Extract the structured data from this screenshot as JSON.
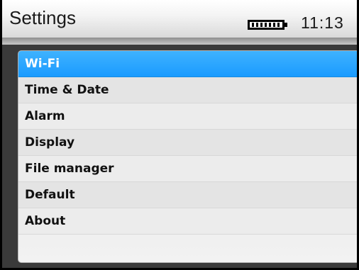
{
  "header": {
    "title": "Settings",
    "time": "11:13",
    "battery_icon": "battery-full-icon"
  },
  "menu": {
    "selected_index": 0,
    "items": [
      {
        "label": "Wi-Fi"
      },
      {
        "label": "Time & Date"
      },
      {
        "label": "Alarm"
      },
      {
        "label": "Display"
      },
      {
        "label": "File manager"
      },
      {
        "label": "Default"
      },
      {
        "label": "About"
      }
    ]
  },
  "colors": {
    "selection": "#1a9bff",
    "selection_text": "#ffffff",
    "menu_text": "#111111"
  }
}
